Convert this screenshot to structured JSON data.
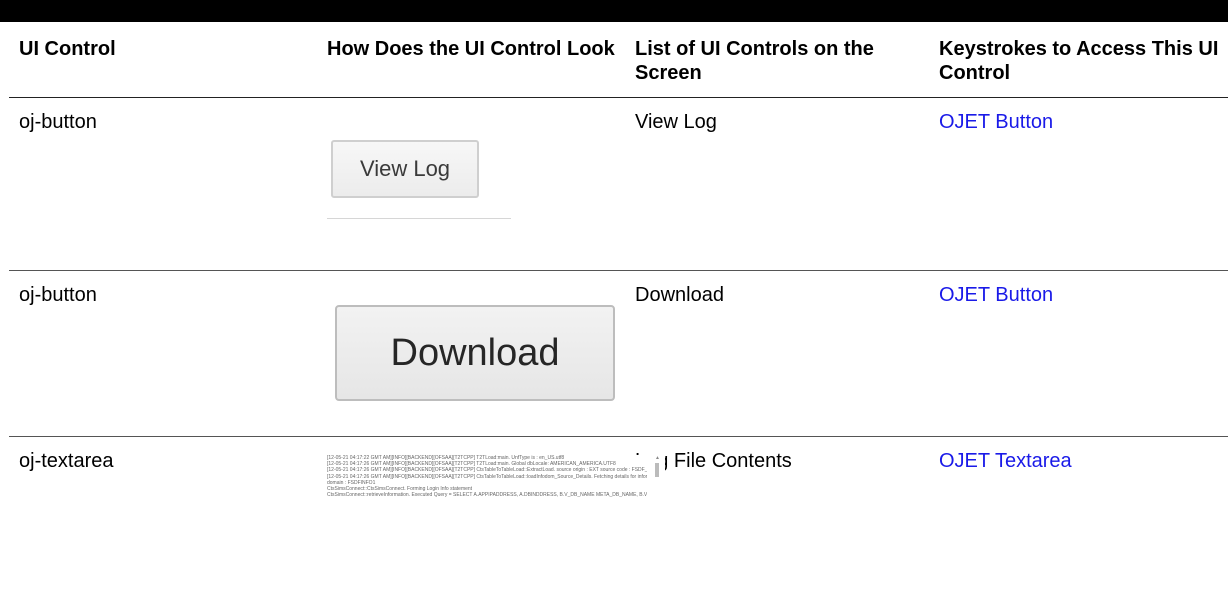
{
  "table": {
    "headers": [
      "UI Control",
      "How Does the UI Control Look",
      "List of UI Controls on the Screen",
      "Keystrokes to Access This UI Control"
    ],
    "rows": [
      {
        "control": "oj-button",
        "look_text": "View Log",
        "list_label": "View Log",
        "keystrokes_link": "OJET Button"
      },
      {
        "control": "oj-button",
        "look_text": "Download",
        "list_label": "Download",
        "keystrokes_link": "OJET Button"
      },
      {
        "control": "oj-textarea",
        "look_lines": [
          "[12-05-21 04:17:22 GMT AM][INFO][BACKEND][OFSAA][T2TCPP] T2TLoad:main. UnfType is : en_US.utf8",
          "[12-05-21 04:17:26 GMT AM][INFO][BACKEND][OFSAA][T2TCPP] T2TLoad:main. Global dbLocale: AMERICAN_AMERICA.UTF8",
          "[12-05-21 04:17:26 GMT AM][INFO][BACKEND][OFSAA][T2TCPP] CtsTableToTableLoad::ExtractLoad. source origin : EXT source code : FSDF_SRC1",
          "[12-05-21 04:17:26 GMT AM][INFO][BACKEND][OFSAA][T2TCPP] CtsTableToTableLoad::loadInfodom_Source_Details. Fetching details for information",
          "domain : FSDFINFO1",
          "CtsSimsConnect::CtsSimsConnect. Forming Login Info statement",
          "CtsSimsConnect::retrieveInformation. Executed Query = SELECT A.APPIPADDRESS, A.DBINDDRESS, B.V_DB_NAME META_DB_NAME, B.V_DB_TYPE"
        ],
        "list_label": "Log File Contents",
        "keystrokes_link": "OJET Textarea"
      }
    ]
  }
}
